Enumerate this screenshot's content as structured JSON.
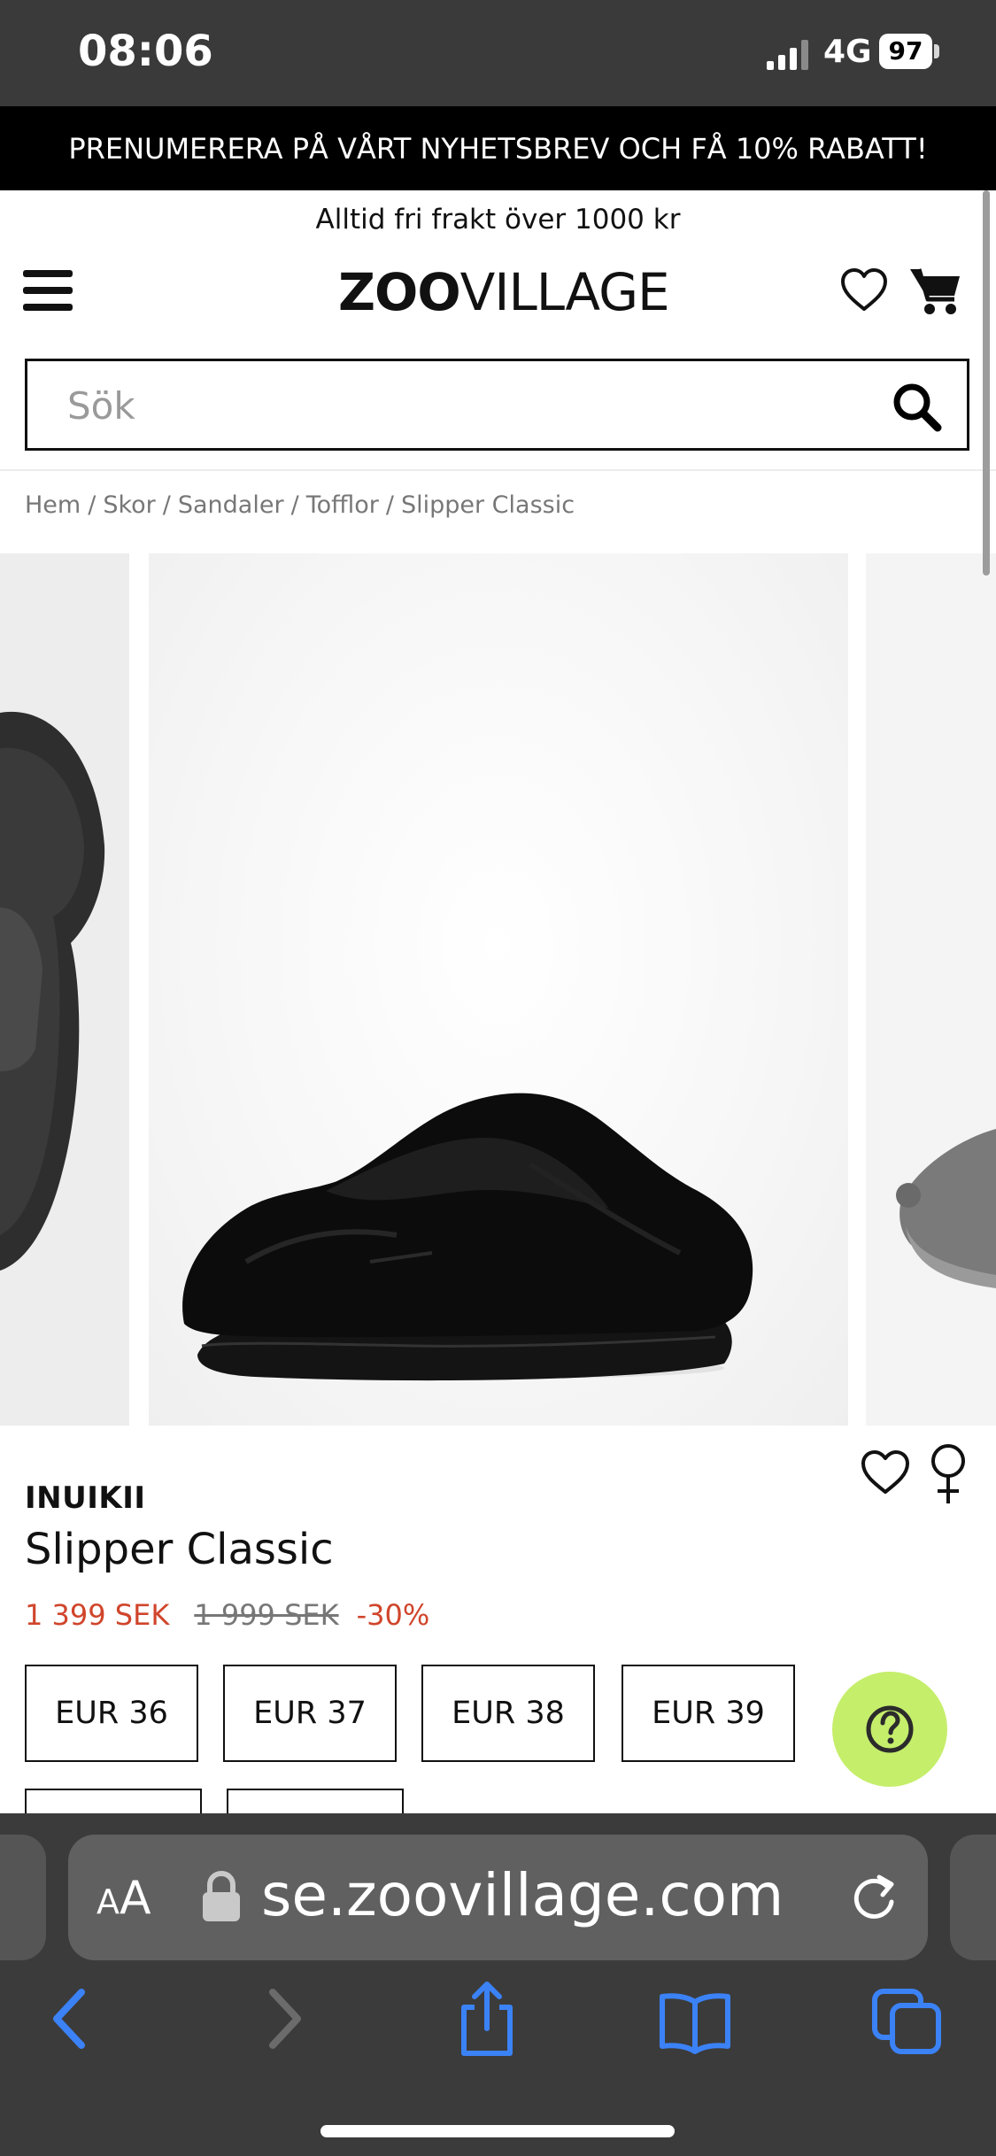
{
  "status_bar": {
    "time": "08:06",
    "network": "4G",
    "battery": "97",
    "icons": [
      "signal-icon",
      "battery-icon"
    ]
  },
  "promo_banner": {
    "text": "PRENUMERERA PÅ VÅRT NYHETSBREV OCH FÅ 10% RABATT!"
  },
  "shipping_notice": {
    "text": "Alltid fri frakt över 1000 kr"
  },
  "header": {
    "logo_bold": "ZOO",
    "logo_regular": "VILLAGE",
    "icons": [
      "menu-icon",
      "heart-icon",
      "cart-icon"
    ]
  },
  "search": {
    "placeholder": "Sök",
    "value": "",
    "icon": "search-icon"
  },
  "breadcrumb": [
    "Hem",
    "Skor",
    "Sandaler",
    "Tofflor",
    "Slipper Classic"
  ],
  "product": {
    "brand": "INUIKII",
    "title": "Slipper Classic",
    "price_current": "1 399 SEK",
    "price_original": "1 999 SEK",
    "discount": "-30%",
    "sizes": [
      "EUR 36",
      "EUR 37",
      "EUR 38",
      "EUR 39"
    ],
    "icons": [
      "heart-icon",
      "female-icon",
      "help-icon"
    ]
  },
  "browser": {
    "text_size_label_big": "A",
    "text_size_label_small": "A",
    "url": "se.zoovillage.com",
    "icons": [
      "lock-icon",
      "reload-icon",
      "back-icon",
      "forward-icon",
      "share-icon",
      "bookmarks-icon",
      "tabs-icon"
    ]
  },
  "colors": {
    "sale_red": "#d0452b",
    "help_green": "#c5ee6b",
    "safari_blue": "#3b82f6"
  }
}
